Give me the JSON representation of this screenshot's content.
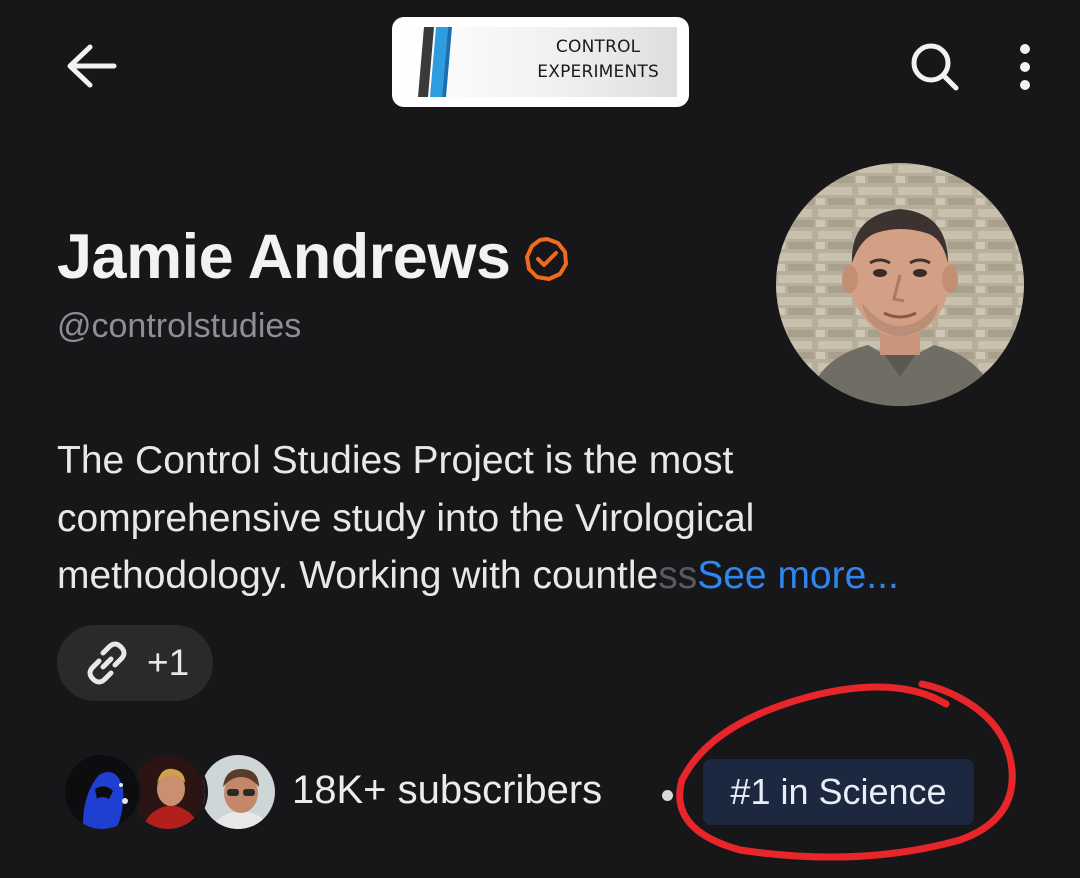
{
  "header": {
    "logo_line1": "CONTROL",
    "logo_line2": "EXPERIMENTS"
  },
  "profile": {
    "name": "Jamie Andrews",
    "handle": "@controlstudies",
    "bio_line1": "The Control Studies Project is the most",
    "bio_line2": "comprehensive study into the Virological",
    "bio_line3": "methodology. Working with countle",
    "bio_line3_fade": "ss",
    "see_more": "See more...",
    "links_count": "+1",
    "subscribers": "18K+ subscribers",
    "rank": "#1 in Science"
  },
  "colors": {
    "background": "#17171a",
    "accent_link": "#2f86f0",
    "verified_badge": "#f26a1b",
    "rank_badge_bg": "#1c2840",
    "annotation": "#e8262a"
  }
}
